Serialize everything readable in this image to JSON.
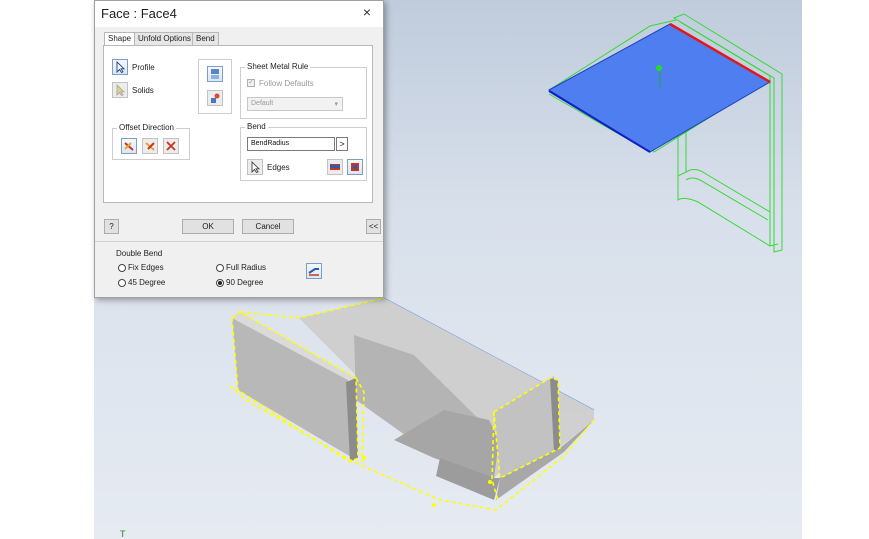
{
  "dialog": {
    "title": "Face : Face4",
    "close_label": "×",
    "tabs": [
      {
        "label": "Shape",
        "active": true
      },
      {
        "label": "Unfold Options",
        "active": false
      },
      {
        "label": "Bend",
        "active": false
      }
    ],
    "selection": {
      "profile_label": "Profile",
      "solids_label": "Solids"
    },
    "sheet_metal_rule": {
      "title": "Sheet Metal Rule",
      "follow_defaults_label": "Follow Defaults",
      "follow_defaults_checked": true,
      "rule_value": "Default"
    },
    "offset_direction": {
      "title": "Offset Direction"
    },
    "bend": {
      "title": "Bend",
      "radius_value": "BendRadius",
      "arrow_label": ">",
      "edges_label": "Edges"
    },
    "buttons": {
      "help_label": "?",
      "ok_label": "OK",
      "cancel_label": "Cancel",
      "collapse_label": "<<"
    },
    "double_bend": {
      "title": "Double Bend",
      "options": [
        {
          "label": "Fix Edges",
          "selected": false
        },
        {
          "label": "Full Radius",
          "selected": false
        },
        {
          "label": "45 Degree",
          "selected": false
        },
        {
          "label": "90 Degree",
          "selected": true
        }
      ]
    }
  },
  "viewport": {
    "ucs_label": "T"
  },
  "colors": {
    "selected_face": "#4f7ef0",
    "selected_edge_red": "#e01a1a",
    "preview_wire": "#38d838",
    "part_highlight": "#ffff00",
    "accent_blue": "#2a6fc7"
  }
}
